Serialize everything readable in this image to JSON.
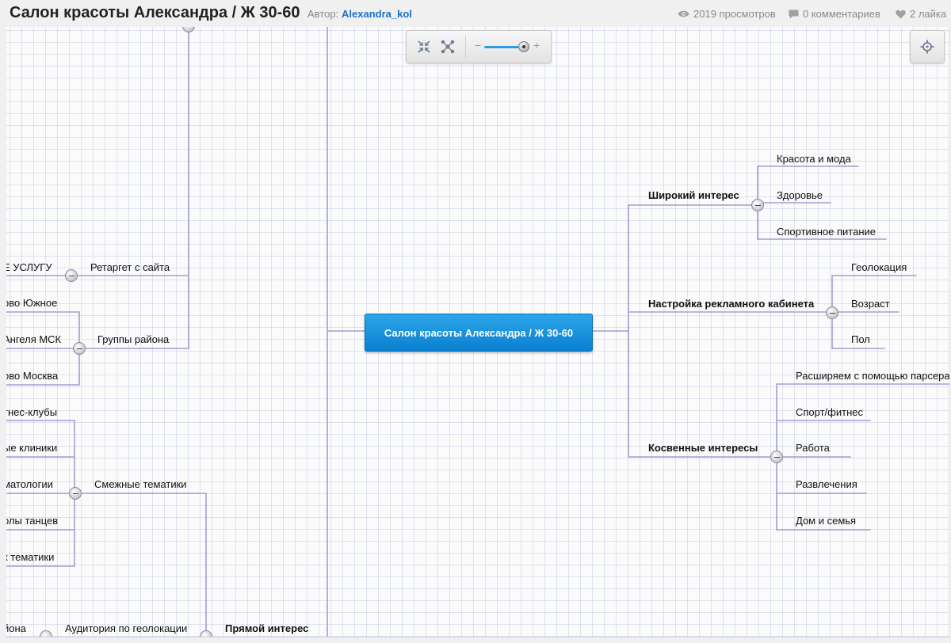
{
  "header": {
    "title": "Салон красоты Александра / Ж 30-60",
    "author_label": "Автор:",
    "author": "Alexandra_kol",
    "views": "2019 просмотров",
    "comments": "0 комментариев",
    "likes": "2 лайка"
  },
  "map": {
    "root": "Салон красоты Александра / Ж 30-60",
    "right": {
      "wide": {
        "label": "Широкий интерес",
        "children": [
          "Красота и мода",
          "Здоровье",
          "Спортивное питание"
        ]
      },
      "setup": {
        "label": "Настройка рекламного кабинета",
        "children": [
          "Геолокация",
          "Возраст",
          "Пол"
        ]
      },
      "indirect": {
        "label": "Косвенные интересы",
        "children": [
          "Расширяем с помощью парсера",
          "Спорт/фитнес",
          "Работа",
          "Развлечения",
          "Дом и семья"
        ]
      }
    },
    "left": {
      "retarget": {
        "label": "Ретаргет с сайта",
        "children": [
          "Е УСЛУГУ"
        ]
      },
      "district": {
        "label": "Группы района",
        "children": [
          "ово Южное",
          "Ангеля МСК",
          "ово Москва"
        ]
      },
      "related": {
        "label": "Смежные тематики",
        "children": [
          "тнес-клубы",
          "ые клиники",
          "матологии",
          "олы танцев",
          "к тематики"
        ]
      },
      "geo": {
        "label": "Аудитория по геолокации",
        "children": [
          "йона"
        ]
      },
      "direct": {
        "label": "Прямой интерес"
      }
    }
  },
  "toolbar": {
    "minus": "−",
    "plus": "+"
  },
  "colors": {
    "link": "#a99bd0",
    "root_bg": "#1b93dd",
    "author_link": "#1a73c4"
  }
}
